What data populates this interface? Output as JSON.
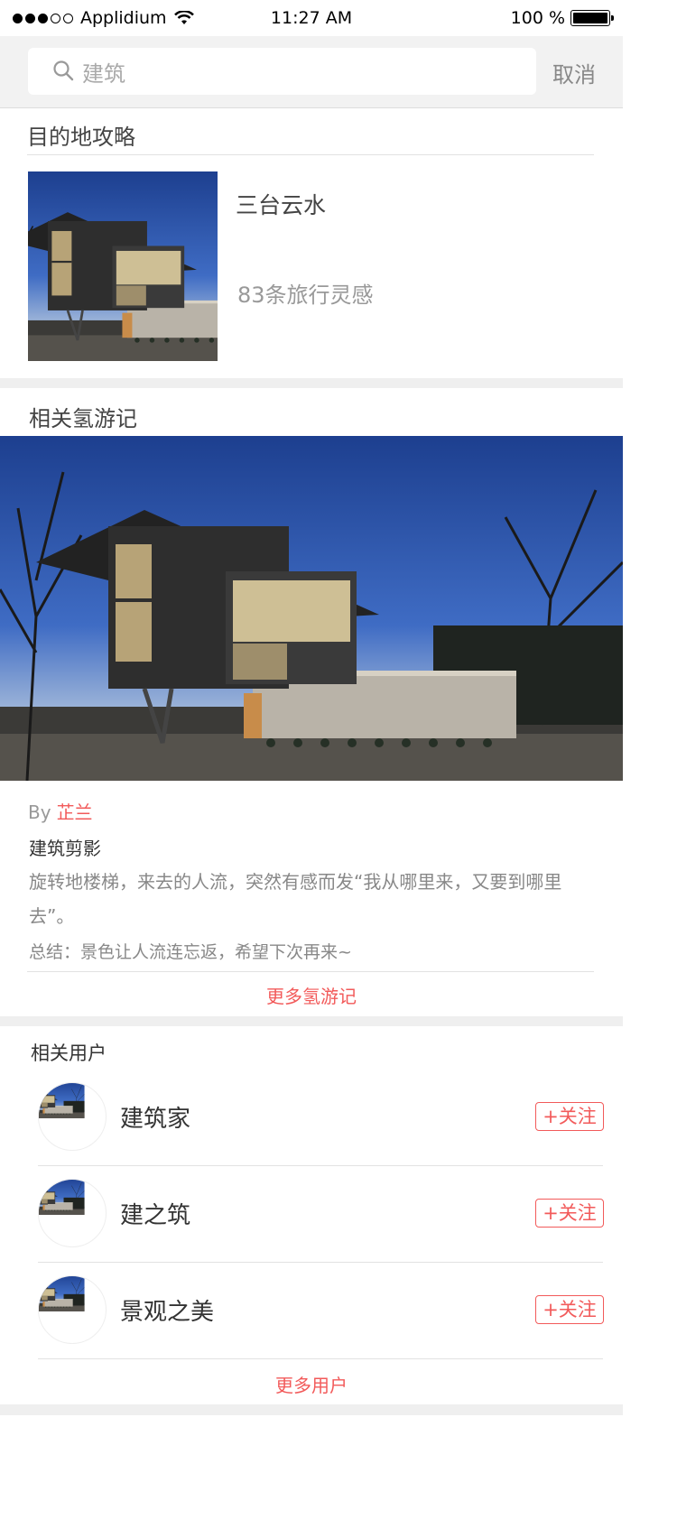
{
  "status_bar": {
    "carrier": "Applidium",
    "time": "11:27 AM",
    "battery": "100 %"
  },
  "search": {
    "value": "建筑",
    "cancel_label": "取消"
  },
  "destination": {
    "section_title": "目的地攻略",
    "name": "三台云水",
    "count_text": "83条旅行灵感"
  },
  "travel_notes": {
    "section_title": "相关氢游记",
    "by_label": "By",
    "author": "芷兰",
    "title": "建筑剪影",
    "body": "旋转地楼梯，来去的人流，突然有感而发“我从哪里来，又要到哪里去”。",
    "summary": "总结：景色让人流连忘返，希望下次再来~",
    "more_label": "更多氢游记"
  },
  "users": {
    "section_title": "相关用户",
    "follow_label": "+关注",
    "items": [
      {
        "name": "建筑家"
      },
      {
        "name": "建之筑"
      },
      {
        "name": "景观之美"
      }
    ],
    "more_label": "更多用户"
  },
  "colors": {
    "accent": "#f25a5a",
    "background_gray": "#efefef"
  },
  "icons": {
    "search": "search-icon",
    "wifi": "wifi-icon",
    "battery": "battery-icon",
    "signal": "signal-dots-icon"
  }
}
